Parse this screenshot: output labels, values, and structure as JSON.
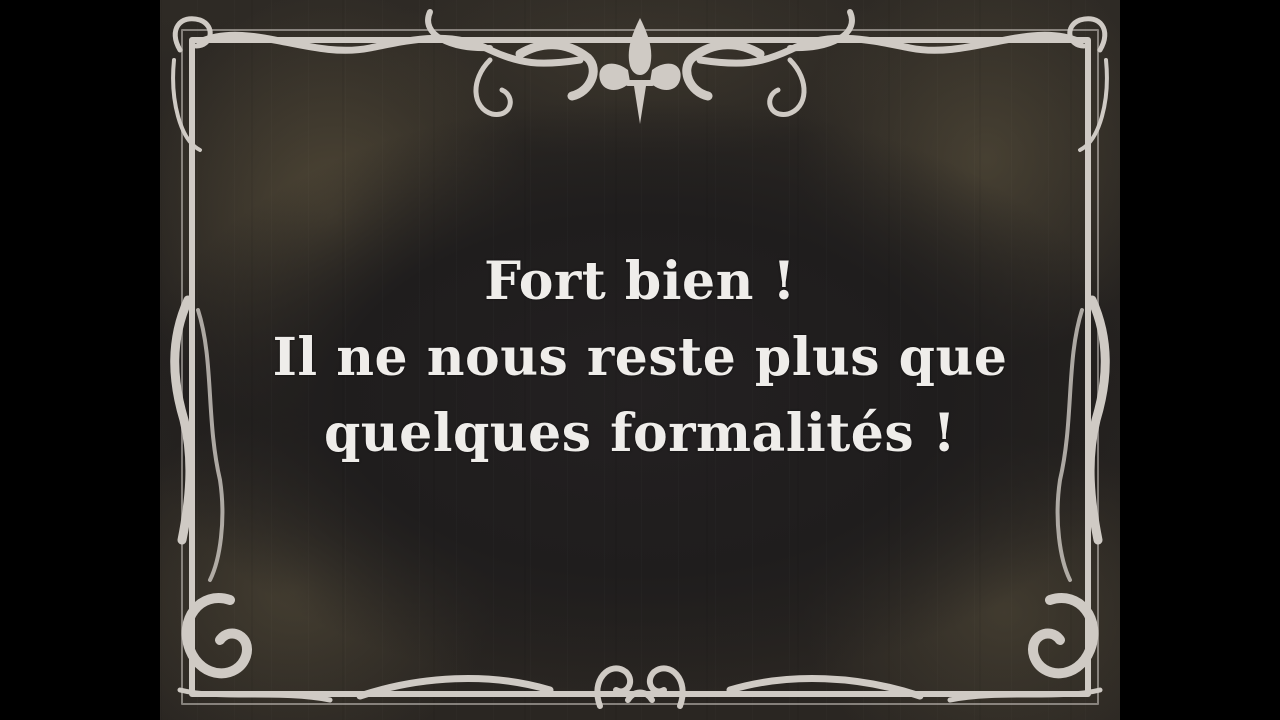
{
  "intertitle": {
    "lines": [
      "Fort bien !",
      "Il ne nous reste plus que",
      "quelques formalités !"
    ]
  },
  "colors": {
    "letterbox": "#000000",
    "card_background": "#24211f",
    "frame_ornament": "#cfcac4",
    "text": "#efedea"
  },
  "icons": {
    "top_center": "fleur-de-lis-icon",
    "bottom_center": "scroll-ornament-icon"
  }
}
